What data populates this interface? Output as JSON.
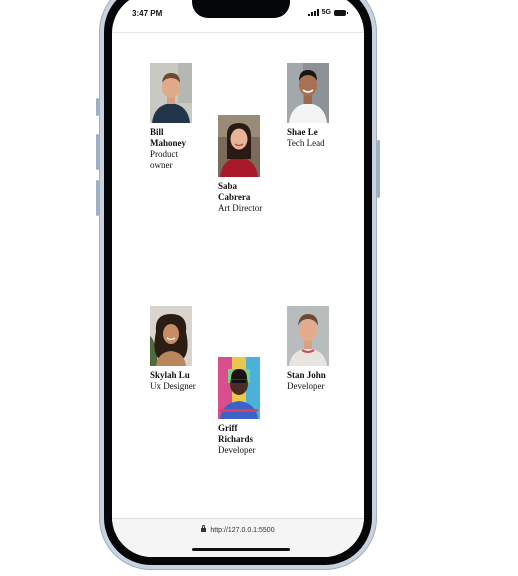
{
  "status_bar": {
    "time": "3:47 PM",
    "network": "5G",
    "icons": [
      "signal-bars-icon",
      "battery-icon"
    ]
  },
  "team": [
    {
      "name": "Bill Mahoney",
      "role": "Product owner",
      "photo": "portrait-photo"
    },
    {
      "name": "Saba Cabrera",
      "role": "Art Director",
      "photo": "portrait-photo"
    },
    {
      "name": "Shae Le",
      "role": "Tech Lead",
      "photo": "portrait-photo"
    },
    {
      "name": "Skylah Lu",
      "role": "Ux Designer",
      "photo": "portrait-photo"
    },
    {
      "name": "Griff Richards",
      "role": "Developer",
      "photo": "portrait-photo"
    },
    {
      "name": "Stan John",
      "role": "Developer",
      "photo": "portrait-photo"
    }
  ],
  "browser": {
    "url": "http://127.0.0.1:5500",
    "icon": "lock-icon"
  }
}
